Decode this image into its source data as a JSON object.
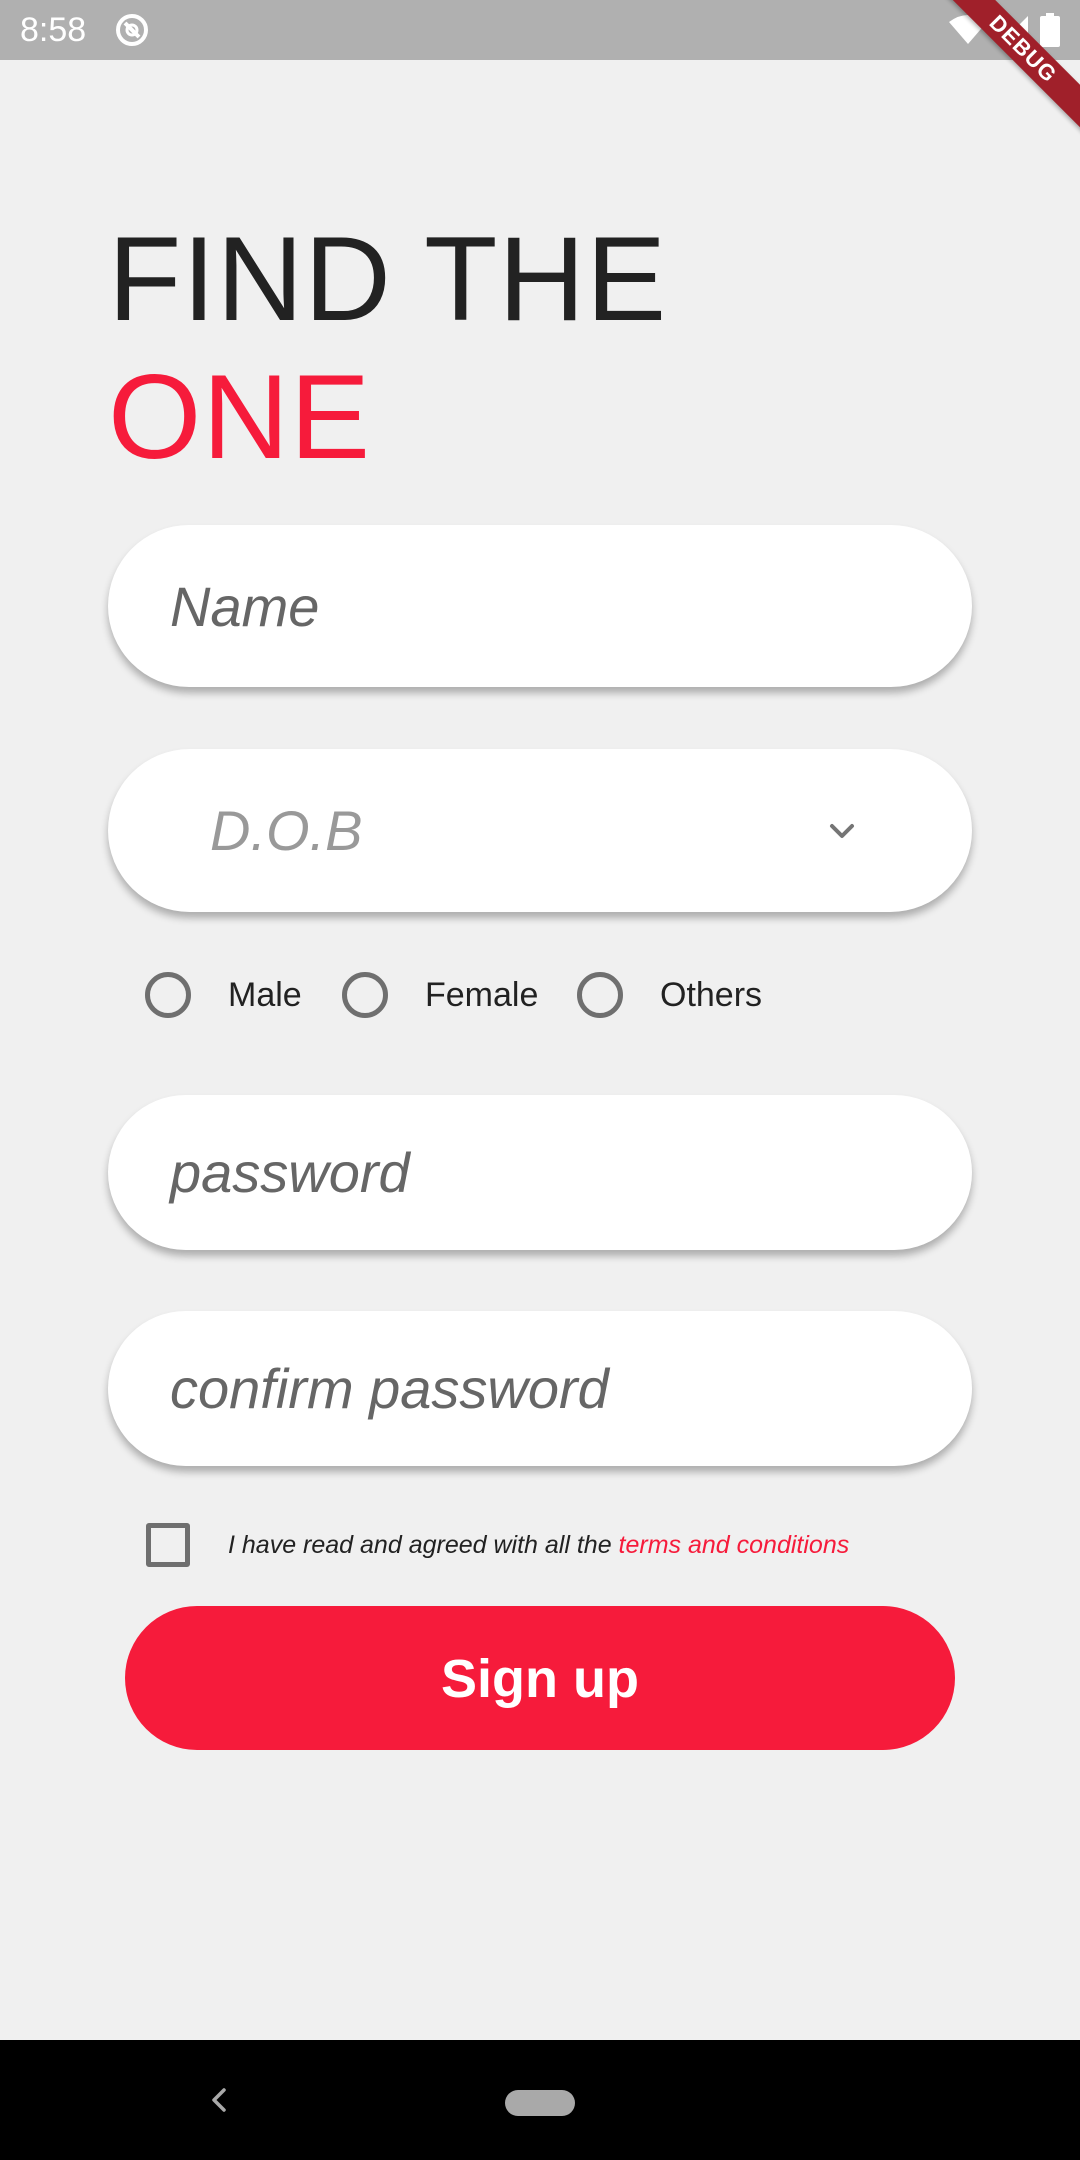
{
  "status_bar": {
    "time": "8:58",
    "icons": [
      "app-notification-icon",
      "wifi-icon",
      "cell-signal-icon",
      "battery-icon"
    ]
  },
  "debug_banner": {
    "label": "DEBUG"
  },
  "heading": {
    "line1": "FIND THE",
    "line2": "ONE"
  },
  "form": {
    "name_placeholder": "Name",
    "dob_placeholder": "D.O.B",
    "gender_options": [
      "Male",
      "Female",
      "Others"
    ],
    "password_placeholder": "password",
    "confirm_password_placeholder": "confirm password",
    "terms_prefix": "I have read and agreed with all the ",
    "terms_link": "terms and conditions",
    "signup_label": "Sign up",
    "terms_checked": false
  },
  "colors": {
    "accent": "#f61b3b",
    "background": "#f0f0f0",
    "heading_dark": "#222222",
    "field_background": "#ffffff"
  },
  "nav_bar": {
    "icons": [
      "back-icon",
      "home-pill-icon"
    ]
  }
}
